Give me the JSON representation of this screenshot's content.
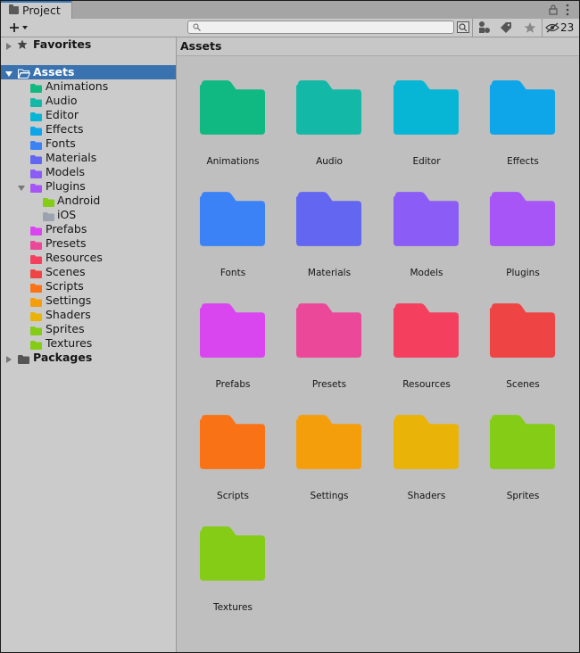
{
  "window": {
    "tab_label": "Project",
    "hidden_count": "23"
  },
  "toolbar": {
    "search_placeholder": ""
  },
  "tree": {
    "favorites": "Favorites",
    "assets": "Assets",
    "packages": "Packages",
    "folders": [
      {
        "label": "Animations",
        "color": "#10b981"
      },
      {
        "label": "Audio",
        "color": "#14b8a6"
      },
      {
        "label": "Editor",
        "color": "#06b6d4"
      },
      {
        "label": "Effects",
        "color": "#0ea5e9"
      },
      {
        "label": "Fonts",
        "color": "#3b82f6"
      },
      {
        "label": "Materials",
        "color": "#6366f1"
      },
      {
        "label": "Models",
        "color": "#8b5cf6"
      },
      {
        "label": "Plugins",
        "color": "#a855f7"
      },
      {
        "label": "Prefabs",
        "color": "#d946ef"
      },
      {
        "label": "Presets",
        "color": "#ec4899"
      },
      {
        "label": "Resources",
        "color": "#f43f5e"
      },
      {
        "label": "Scenes",
        "color": "#ef4444"
      },
      {
        "label": "Scripts",
        "color": "#f97316"
      },
      {
        "label": "Settings",
        "color": "#f59e0b"
      },
      {
        "label": "Shaders",
        "color": "#eab308"
      },
      {
        "label": "Sprites",
        "color": "#84cc16"
      },
      {
        "label": "Textures",
        "color": "#84cc16"
      }
    ],
    "plugin_children": [
      {
        "label": "Android",
        "color": "#84cc16"
      },
      {
        "label": "iOS",
        "color": "#9ca3af"
      }
    ]
  },
  "grid": {
    "header": "Assets",
    "items": [
      {
        "label": "Animations",
        "color": "#10b981"
      },
      {
        "label": "Audio",
        "color": "#14b8a6"
      },
      {
        "label": "Editor",
        "color": "#06b6d4"
      },
      {
        "label": "Effects",
        "color": "#0ea5e9"
      },
      {
        "label": "Fonts",
        "color": "#3b82f6"
      },
      {
        "label": "Materials",
        "color": "#6366f1"
      },
      {
        "label": "Models",
        "color": "#8b5cf6"
      },
      {
        "label": "Plugins",
        "color": "#a855f7"
      },
      {
        "label": "Prefabs",
        "color": "#d946ef"
      },
      {
        "label": "Presets",
        "color": "#ec4899"
      },
      {
        "label": "Resources",
        "color": "#f43f5e"
      },
      {
        "label": "Scenes",
        "color": "#ef4444"
      },
      {
        "label": "Scripts",
        "color": "#f97316"
      },
      {
        "label": "Settings",
        "color": "#f59e0b"
      },
      {
        "label": "Shaders",
        "color": "#eab308"
      },
      {
        "label": "Sprites",
        "color": "#84cc16"
      },
      {
        "label": "Textures",
        "color": "#84cc16"
      }
    ]
  },
  "accent": "#3a72b0"
}
